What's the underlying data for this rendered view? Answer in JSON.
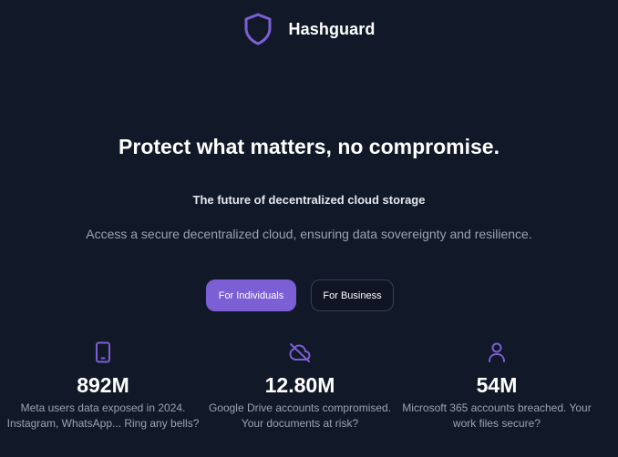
{
  "brand": {
    "name": "Hashguard",
    "logo_icon": "shield-icon",
    "accent": "#7c5fd4"
  },
  "hero": {
    "title": "Protect what matters, no compromise.",
    "subtitle": "The future of decentralized cloud storage",
    "description": "Access a secure decentralized cloud, ensuring data sovereignty and resilience."
  },
  "actions": {
    "individuals_label": "For Individuals",
    "business_label": "For Business"
  },
  "stats": [
    {
      "icon": "smartphone-icon",
      "value": "892M",
      "line1": "Meta users data exposed in 2024.",
      "line2": "Instagram, WhatsApp... Ring any bells?"
    },
    {
      "icon": "cloud-off-icon",
      "value": "12.80M",
      "line1": "Google Drive accounts compromised.",
      "line2": "Your documents at risk?"
    },
    {
      "icon": "user-icon",
      "value": "54M",
      "line1": "Microsoft 365 accounts breached. Your",
      "line2": "work files secure?"
    }
  ],
  "colors": {
    "background": "#111827",
    "text_primary": "#ffffff",
    "text_muted": "#9ca3af",
    "button_secondary_border": "#374151"
  }
}
